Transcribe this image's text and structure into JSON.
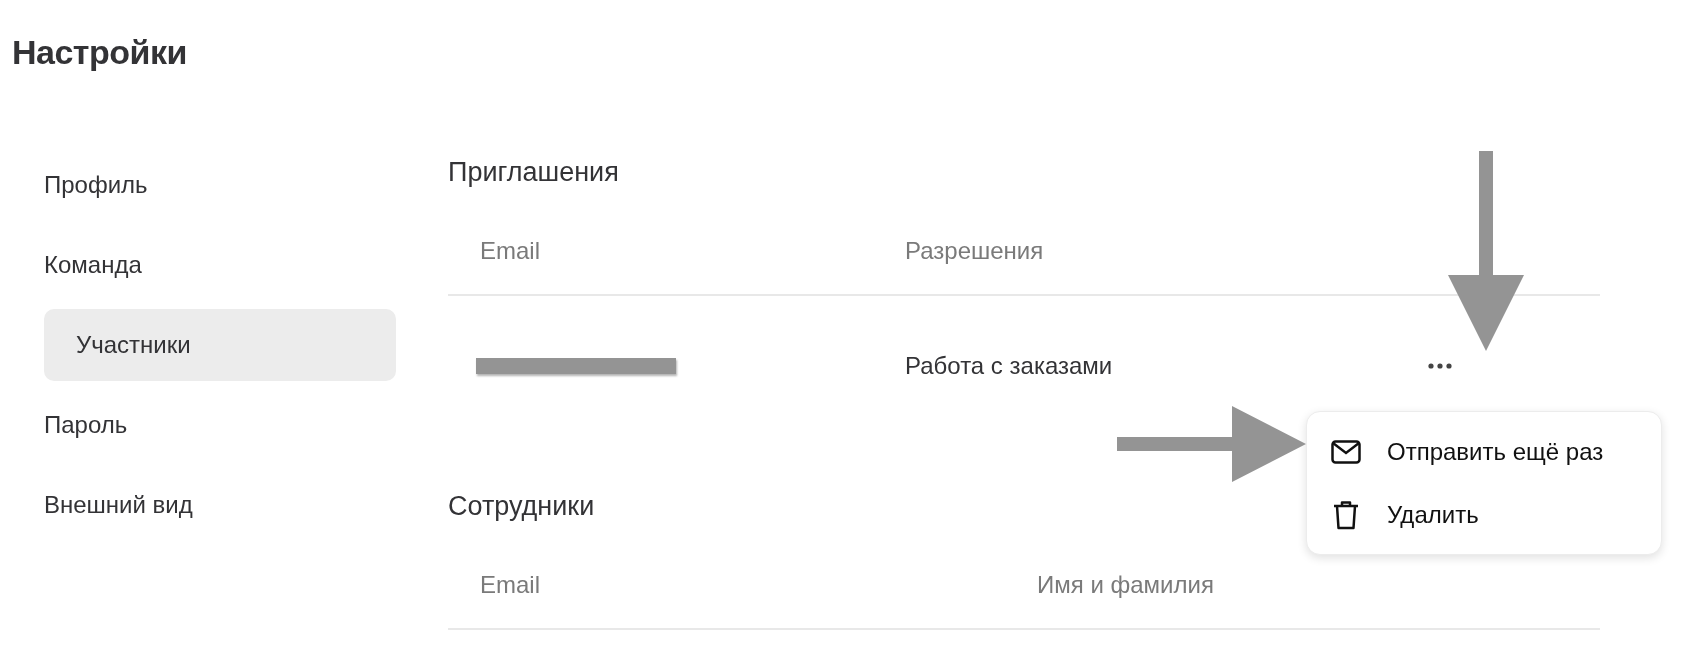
{
  "page_title": "Настройки",
  "sidebar": {
    "items": [
      {
        "label": "Профиль",
        "selected": false
      },
      {
        "label": "Команда",
        "selected": false,
        "children": [
          {
            "label": "Участники",
            "selected": true
          }
        ]
      },
      {
        "label": "Пароль",
        "selected": false
      },
      {
        "label": "Внешний вид",
        "selected": false
      }
    ]
  },
  "invitations": {
    "title": "Приглашения",
    "columns": [
      "Email",
      "Разрешения"
    ],
    "rows": [
      {
        "email_redacted": true,
        "permissions": "Работа с заказами"
      }
    ]
  },
  "row_menu": {
    "items": [
      {
        "kind": "resend",
        "label": "Отправить ещё раз"
      },
      {
        "kind": "delete",
        "label": "Удалить"
      }
    ]
  },
  "employees": {
    "title": "Сотрудники",
    "columns": [
      "Email",
      "Имя и фамилия"
    ]
  }
}
